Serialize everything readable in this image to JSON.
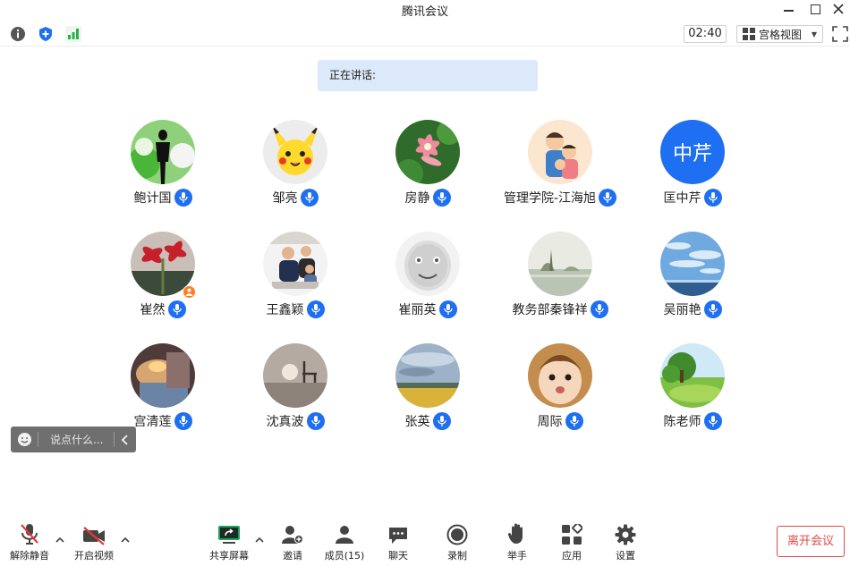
{
  "window": {
    "title": "腾讯会议"
  },
  "toolbar": {
    "timer": "02:40",
    "view_label": "宫格视图",
    "icons": [
      "info-icon",
      "shield-icon",
      "signal-icon",
      "grid-view-icon",
      "fullscreen-icon"
    ]
  },
  "speaking": {
    "label": "正在讲话:"
  },
  "participants": [
    {
      "name": "鲍计国"
    },
    {
      "name": "邹亮"
    },
    {
      "name": "房静"
    },
    {
      "name": "管理学院-江海旭"
    },
    {
      "name": "匡中芹",
      "avatar_text": "中芹"
    },
    {
      "name": "崔然"
    },
    {
      "name": "王鑫颖"
    },
    {
      "name": "崔丽英"
    },
    {
      "name": "教务部秦锋祥"
    },
    {
      "name": "吴丽艳"
    },
    {
      "name": "宫清莲"
    },
    {
      "name": "沈真波"
    },
    {
      "name": "张英"
    },
    {
      "name": "周际"
    },
    {
      "name": "陈老师"
    }
  ],
  "chat": {
    "placeholder": "说点什么..."
  },
  "bottombar": {
    "unmute": "解除静音",
    "video": "开启视频",
    "share": "共享屏幕",
    "invite": "邀请",
    "members": "成员(15)",
    "chat": "聊天",
    "record": "录制",
    "raise_hand": "举手",
    "apps": "应用",
    "settings": "设置",
    "leave": "离开会议"
  },
  "colors": {
    "accent": "#1f6ff2",
    "speaking_bg": "#dce9fb",
    "leave": "#e24a4a",
    "host_badge": "#ff7d20",
    "share_green": "#1aa260"
  }
}
